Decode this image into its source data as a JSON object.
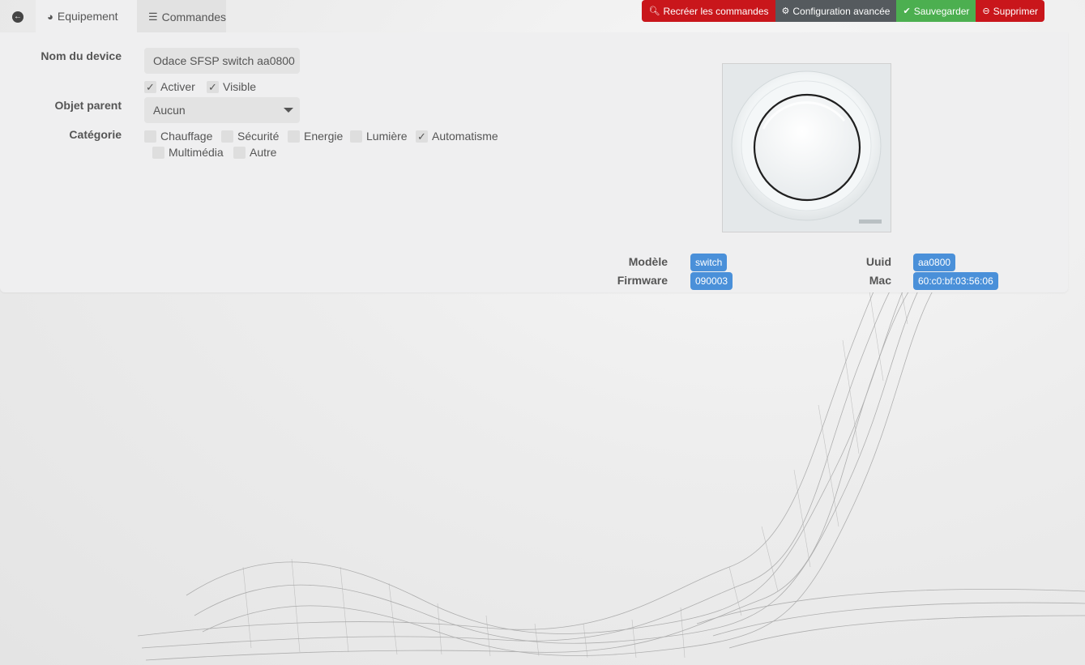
{
  "tabs": {
    "equipement": "Equipement",
    "commandes": "Commandes"
  },
  "actions": {
    "recreate": "Recréer les commandes",
    "advanced": "Configuration avancée",
    "save": "Sauvegarder",
    "delete": "Supprimer"
  },
  "form": {
    "device_name_label": "Nom du device",
    "device_name_value": "Odace SFSP switch aa0800",
    "activer": "Activer",
    "visible": "Visible",
    "parent_label": "Objet parent",
    "parent_value": "Aucun",
    "category_label": "Catégorie",
    "categories": {
      "chauffage": "Chauffage",
      "securite": "Sécurité",
      "energie": "Energie",
      "lumiere": "Lumière",
      "automatisme": "Automatisme",
      "multimedia": "Multimédia",
      "autre": "Autre"
    }
  },
  "info": {
    "model_label": "Modèle",
    "model_value": "switch",
    "firmware_label": "Firmware",
    "firmware_value": "090003",
    "uuid_label": "Uuid",
    "uuid_value": "aa0800",
    "mac_label": "Mac",
    "mac_value": "60:c0:bf:03:56:06"
  },
  "colors": {
    "red": "#c9161b",
    "dark": "#555a5e",
    "green": "#4caf50",
    "badge": "#4a90d9",
    "tab_accent": "#8bc34a"
  },
  "icons": {
    "back": "arrow-circle-left-icon",
    "equipement": "tachometer-icon",
    "commandes": "list-icon",
    "recreate": "search-icon",
    "advanced": "cogs-icon",
    "save": "check-circle-icon",
    "delete": "minus-circle-icon"
  }
}
